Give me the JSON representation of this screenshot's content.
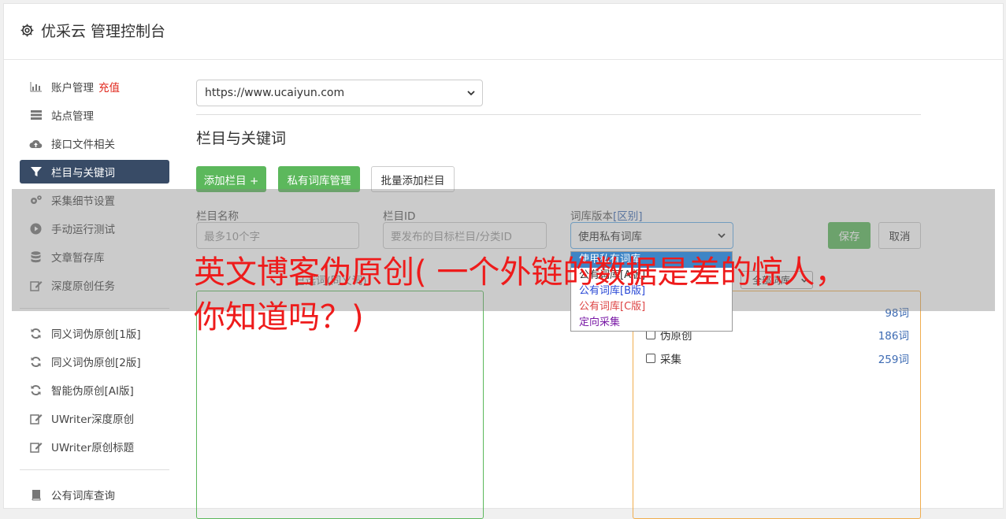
{
  "brand": {
    "title": "优采云 管理控制台",
    "icon": "gear-icon"
  },
  "sidebar": {
    "items": [
      {
        "label": "账户管理",
        "badge": "充值",
        "icon": "bar-chart-icon",
        "active": false
      },
      {
        "label": "站点管理",
        "icon": "server-icon",
        "active": false
      },
      {
        "label": "接口文件相关",
        "icon": "cloud-upload-icon",
        "active": false
      },
      {
        "label": "栏目与关键词",
        "icon": "filter-icon",
        "active": true
      },
      {
        "label": "采集细节设置",
        "icon": "cogs-icon",
        "active": false
      },
      {
        "label": "手动运行测试",
        "icon": "play-icon",
        "active": false
      },
      {
        "label": "文章暂存库",
        "icon": "database-icon",
        "active": false
      },
      {
        "label": "深度原创任务",
        "icon": "edit-icon",
        "active": false
      }
    ],
    "items2": [
      {
        "label": "同义词伪原创[1版]",
        "icon": "refresh-icon"
      },
      {
        "label": "同义词伪原创[2版]",
        "icon": "refresh-icon"
      },
      {
        "label": "智能伪原创[AI版]",
        "icon": "refresh-icon"
      },
      {
        "label": "UWriter深度原创",
        "icon": "edit-icon"
      },
      {
        "label": "UWriter原创标题",
        "icon": "edit-icon"
      }
    ],
    "items3": [
      {
        "label": "公有词库查询",
        "icon": "book-icon"
      }
    ]
  },
  "main": {
    "site_select": "https://www.ucaiyun.com",
    "section_title": "栏目与关键词",
    "buttons": {
      "add_column": "添加栏目 +",
      "private_lib": "私有词库管理",
      "batch_add": "批量添加栏目"
    },
    "form": {
      "name_label": "栏目名称",
      "name_placeholder": "最多10个字",
      "id_label": "栏目ID",
      "id_placeholder": "要发布的目标栏目/分类ID",
      "lib_label": "词库版本",
      "lib_label_link": "[区别]",
      "lib_value": "使用私有词库",
      "save": "保存",
      "cancel": "取消"
    },
    "dropdown_options": [
      "使用私有词库",
      "公有词库[A版]",
      "公有词库[B版]",
      "公有词库[C版]",
      "定向采集"
    ],
    "panel_hint": "已选词(同义词)",
    "filter_select": "全部词库",
    "libraries": [
      {
        "label": "",
        "count": "98词"
      },
      {
        "label": "伪原创",
        "count": "186词"
      },
      {
        "label": "采集",
        "count": "259词"
      }
    ]
  },
  "ad": {
    "title": "英文博客伪原创( 一个外链的数据是差的惊人，你知道吗？)"
  },
  "colors": {
    "accent_green": "#5cb85c",
    "active_nav": "#384b66",
    "ad_red": "#ee1b1b"
  }
}
